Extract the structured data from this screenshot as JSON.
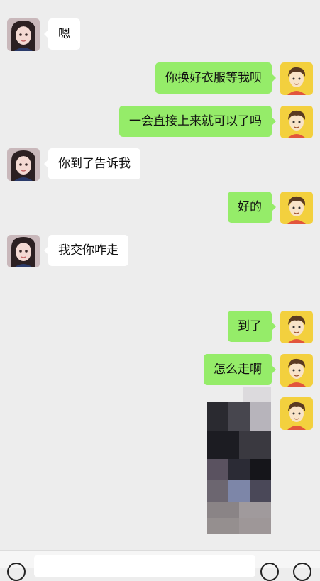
{
  "contacts": {
    "other": {
      "avatar_icon": "girl-portrait-avatar-icon"
    },
    "self": {
      "avatar_icon": "cartoon-boy-avatar-icon",
      "avatar_bg": "#f3d03e"
    }
  },
  "messages": [
    {
      "from": "other",
      "text": "嗯"
    },
    {
      "from": "self",
      "text": "你换好衣服等我呗"
    },
    {
      "from": "self",
      "text": "一会直接上来就可以了吗"
    },
    {
      "from": "other",
      "text": "你到了告诉我"
    },
    {
      "from": "self",
      "text": "好的"
    },
    {
      "from": "other",
      "text": "我交你咋走"
    },
    {
      "from": "self",
      "text": "到了"
    },
    {
      "from": "self",
      "text": "怎么走啊"
    },
    {
      "from": "self",
      "type": "image",
      "content": "pixelated-photo"
    }
  ],
  "colors": {
    "background": "#ededed",
    "bubble_self": "#95ec69",
    "bubble_other": "#ffffff"
  },
  "input_bar": {
    "voice_icon": "voice-icon",
    "emoji_icon": "emoji-icon",
    "plus_icon": "plus-icon"
  }
}
